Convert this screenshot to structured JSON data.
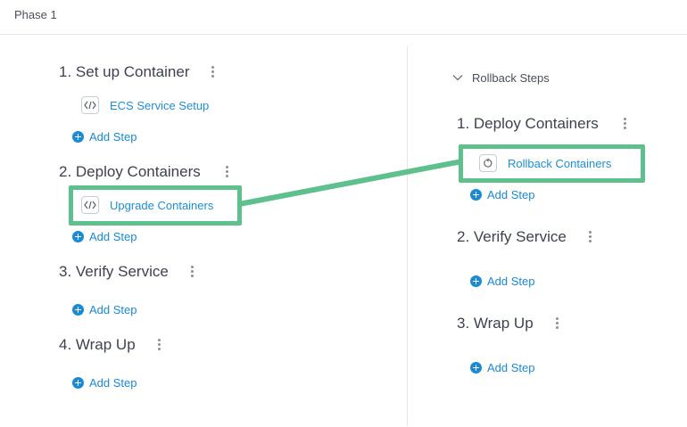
{
  "header": {
    "title": "Phase 1"
  },
  "deploy_phases": [
    {
      "title": "1. Set up Container",
      "steps": [
        {
          "label": "ECS Service Setup",
          "icon": "code-icon"
        }
      ],
      "add_label": "Add Step"
    },
    {
      "title": "2. Deploy Containers",
      "steps": [
        {
          "label": "Upgrade Containers",
          "icon": "code-icon"
        }
      ],
      "add_label": "Add Step"
    },
    {
      "title": "3. Verify Service",
      "steps": [],
      "add_label": "Add Step"
    },
    {
      "title": "4. Wrap Up",
      "steps": [],
      "add_label": "Add Step"
    }
  ],
  "rollback": {
    "header_label": "Rollback Steps",
    "phases": [
      {
        "title": "1. Deploy Containers",
        "steps": [
          {
            "label": "Rollback Containers",
            "icon": "rollback-icon"
          }
        ],
        "add_label": "Add Step"
      },
      {
        "title": "2. Verify Service",
        "steps": [],
        "add_label": "Add Step"
      },
      {
        "title": "3. Wrap Up",
        "steps": [],
        "add_label": "Add Step"
      }
    ]
  },
  "colors": {
    "link": "#1c8fd8",
    "add_button": "#1a8ad4",
    "highlight": "#5ec08c",
    "text": "#3e4250"
  }
}
